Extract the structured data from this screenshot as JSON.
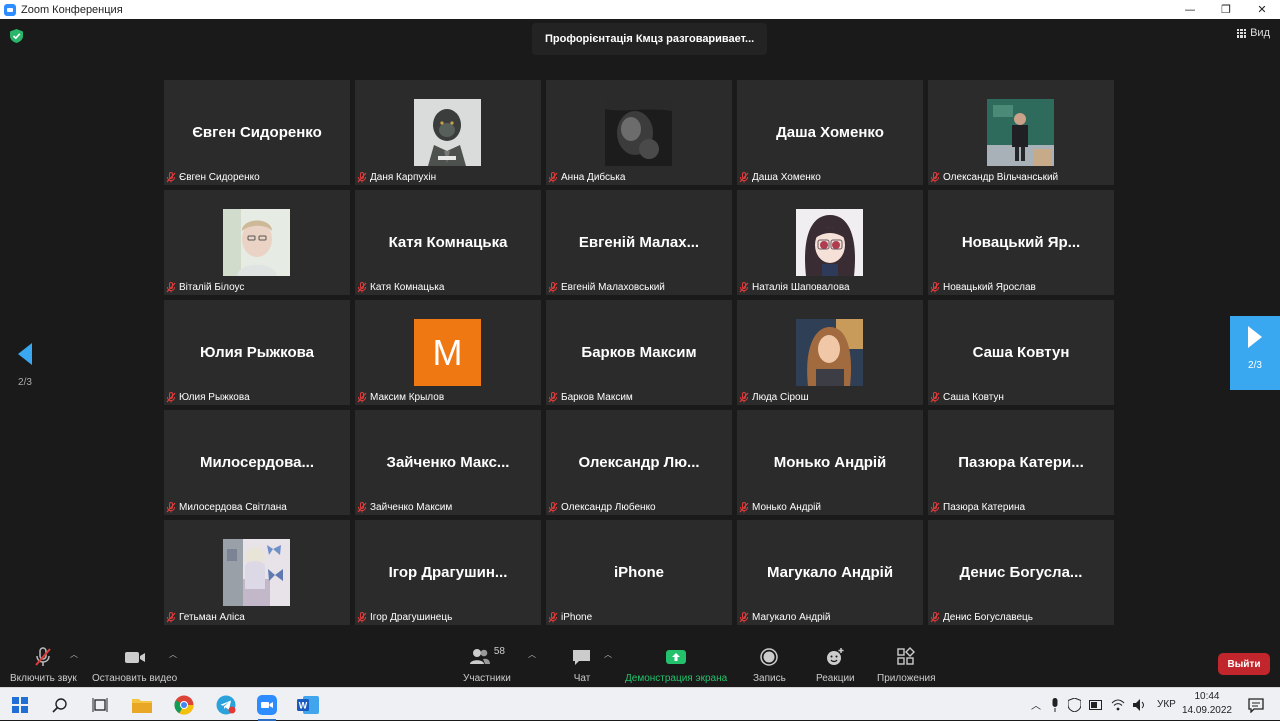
{
  "window": {
    "title": "Zoom Конференция",
    "min": "—",
    "max": "❐",
    "close": "✕"
  },
  "meeting": {
    "speaking": "Профорієнтація Кмцз разговаривает...",
    "view_label": "Вид",
    "page_indicator": "2/3",
    "colors": {
      "background": "#1a1a1a",
      "tile": "#2b2b2b",
      "next_arrow": "#39a8f0",
      "exit": "#c0262b",
      "mute": "#e03b3b"
    }
  },
  "participants": [
    {
      "name": "Євген Сидоренко",
      "display": "Євген Сидоренко",
      "avatar": ""
    },
    {
      "name": "Даня Карпухін",
      "display": "",
      "avatar": "monkey-photo"
    },
    {
      "name": "Анна Дибська",
      "display": "",
      "avatar": "bw-photo"
    },
    {
      "name": "Даша Хоменко",
      "display": "Даша Хоменко",
      "avatar": ""
    },
    {
      "name": "Олександр Вільчанський",
      "display": "",
      "avatar": "classroom-photo"
    },
    {
      "name": "Віталій Білоус",
      "display": "",
      "avatar": "boy-photo"
    },
    {
      "name": "Катя Комнацька",
      "display": "Катя Комнацька",
      "avatar": ""
    },
    {
      "name": "Евгеній Малаховський",
      "display": "Евгеній Малах...",
      "avatar": ""
    },
    {
      "name": "Наталія Шаповалова",
      "display": "",
      "avatar": "anime-photo"
    },
    {
      "name": "Новацький Ярослав",
      "display": "Новацький Яр...",
      "avatar": ""
    },
    {
      "name": "Юлия Рыжкова",
      "display": "Юлия Рыжкова",
      "avatar": ""
    },
    {
      "name": "Максим Крылов",
      "display": "",
      "avatar": "letter-m",
      "letter": "M"
    },
    {
      "name": "Барков Максим",
      "display": "Барков Максим",
      "avatar": ""
    },
    {
      "name": "Люда Сірош",
      "display": "",
      "avatar": "girl-photo"
    },
    {
      "name": "Саша Ковтун",
      "display": "Саша Ковтун",
      "avatar": ""
    },
    {
      "name": "Милосердова Світлана",
      "display": "Милосердова...",
      "avatar": ""
    },
    {
      "name": "Зайченко Максим",
      "display": "Зайченко Макс...",
      "avatar": ""
    },
    {
      "name": "Олександр Любенко",
      "display": "Олександр Лю...",
      "avatar": ""
    },
    {
      "name": "Монько Андрій",
      "display": "Монько Андрій",
      "avatar": ""
    },
    {
      "name": "Пазюра Катерина",
      "display": "Пазюра Катери...",
      "avatar": ""
    },
    {
      "name": "Гетьман Аліса",
      "display": "",
      "avatar": "butterfly-photo"
    },
    {
      "name": "Ігор Драгушинець",
      "display": "Ігор Драгушин...",
      "avatar": ""
    },
    {
      "name": "iPhone",
      "display": "iPhone",
      "avatar": ""
    },
    {
      "name": "Магукало Андрій",
      "display": "Магукало Андрій",
      "avatar": ""
    },
    {
      "name": "Денис Богуславець",
      "display": "Денис Богусла...",
      "avatar": ""
    }
  ],
  "toolbar": {
    "unmute": "Включить звук",
    "stop_video": "Остановить видео",
    "participants": "Участники",
    "participants_count": "58",
    "chat": "Чат",
    "share": "Демонстрация экрана",
    "record": "Запись",
    "reactions": "Реакции",
    "apps": "Приложения",
    "leave": "Выйти"
  },
  "taskbar": {
    "language": "УКР",
    "time": "10:44",
    "date": "14.09.2022"
  }
}
